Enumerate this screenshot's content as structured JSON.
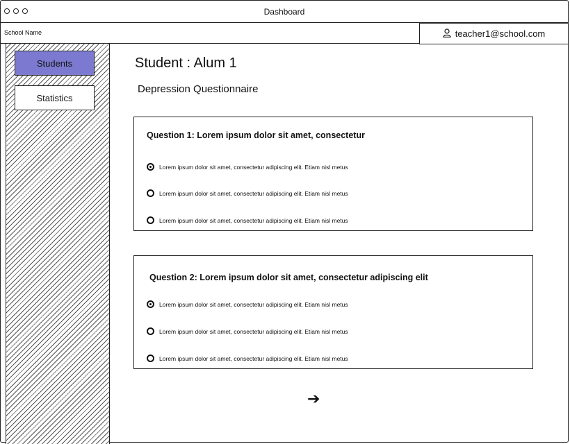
{
  "window": {
    "title": "Dashboard"
  },
  "header": {
    "school_name": "School Name",
    "user_email": "teacher1@school.com",
    "user_icon": "user-icon"
  },
  "sidebar": {
    "items": [
      {
        "label": "Students",
        "active": true
      },
      {
        "label": "Statistics",
        "active": false
      }
    ],
    "active_color": "#7b7ad0"
  },
  "main": {
    "title": "Student : Alum 1",
    "subtitle": "Depression Questionnaire",
    "questions": [
      {
        "title": "Question 1: Lorem ipsum dolor sit amet, consectetur",
        "options": [
          {
            "label": "Lorem ipsum dolor sit amet, consectetur adipiscing elit. Etiam nisl metus",
            "selected": true
          },
          {
            "label": "Lorem ipsum dolor sit amet, consectetur adipiscing elit. Etiam nisl metus",
            "selected": false
          },
          {
            "label": "Lorem ipsum dolor sit amet, consectetur adipiscing elit. Etiam nisl metus",
            "selected": false
          }
        ]
      },
      {
        "title": "Question 2: Lorem ipsum dolor sit amet, consectetur adipiscing elit",
        "options": [
          {
            "label": "Lorem ipsum dolor sit amet, consectetur adipiscing elit. Etiam nisl metus",
            "selected": true
          },
          {
            "label": "Lorem ipsum dolor sit amet, consectetur adipiscing elit. Etiam nisl metus",
            "selected": false
          },
          {
            "label": "Lorem ipsum dolor sit amet, consectetur adipiscing elit. Etiam nisl metus",
            "selected": false
          }
        ]
      }
    ],
    "next_icon": "arrow-right-icon",
    "next_glyph": "➔"
  }
}
